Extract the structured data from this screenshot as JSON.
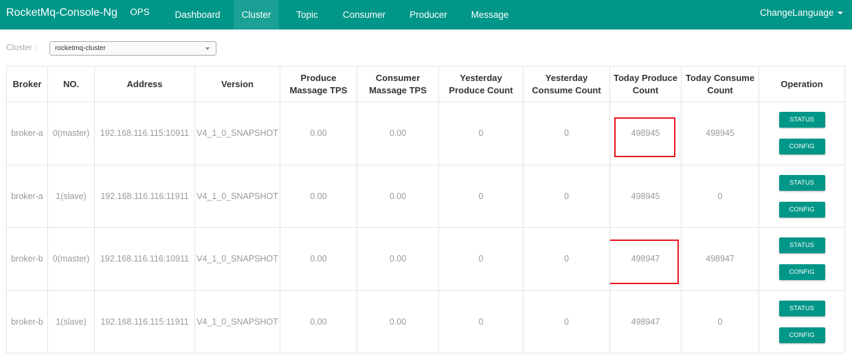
{
  "navbar": {
    "brand": "RocketMq-Console-Ng",
    "items": [
      {
        "label": "OPS",
        "active": false
      },
      {
        "label": "Dashboard",
        "active": false
      },
      {
        "label": "Cluster",
        "active": true
      },
      {
        "label": "Topic",
        "active": false
      },
      {
        "label": "Consumer",
        "active": false
      },
      {
        "label": "Producer",
        "active": false
      },
      {
        "label": "Message",
        "active": false
      }
    ],
    "language": "ChangeLanguage"
  },
  "cluster_filter": {
    "label": "Cluster :",
    "selected": "rocketmq-cluster"
  },
  "table": {
    "headers": [
      "Broker",
      "NO.",
      "Address",
      "Version",
      "Produce Massage TPS",
      "Consumer Massage TPS",
      "Yesterday Produce Count",
      "Yesterday Consume Count",
      "Today Produce Count",
      "Today Consume Count",
      "Operation"
    ],
    "rows": [
      {
        "broker": "broker-a",
        "no": "0(master)",
        "address": "192.168.116.115:10911",
        "version": "V4_1_0_SNAPSHOT",
        "produce_tps": "0.00",
        "consumer_tps": "0.00",
        "yesterday_produce": "0",
        "yesterday_consume": "0",
        "today_produce": "498945",
        "today_consume": "498945"
      },
      {
        "broker": "broker-a",
        "no": "1(slave)",
        "address": "192.168.116.116:11911",
        "version": "V4_1_0_SNAPSHOT",
        "produce_tps": "0.00",
        "consumer_tps": "0.00",
        "yesterday_produce": "0",
        "yesterday_consume": "0",
        "today_produce": "498945",
        "today_consume": "0"
      },
      {
        "broker": "broker-b",
        "no": "0(master)",
        "address": "192.168.116.116:10911",
        "version": "V4_1_0_SNAPSHOT",
        "produce_tps": "0.00",
        "consumer_tps": "0.00",
        "yesterday_produce": "0",
        "yesterday_consume": "0",
        "today_produce": "498947",
        "today_consume": "498947"
      },
      {
        "broker": "broker-b",
        "no": "1(slave)",
        "address": "192.168.116.115:11911",
        "version": "V4_1_0_SNAPSHOT",
        "produce_tps": "0.00",
        "consumer_tps": "0.00",
        "yesterday_produce": "0",
        "yesterday_consume": "0",
        "today_produce": "498947",
        "today_consume": "0"
      }
    ],
    "status_label": "STATUS",
    "config_label": "CONFIG"
  },
  "colors": {
    "primary": "#009688",
    "highlight": "#e8151b"
  }
}
